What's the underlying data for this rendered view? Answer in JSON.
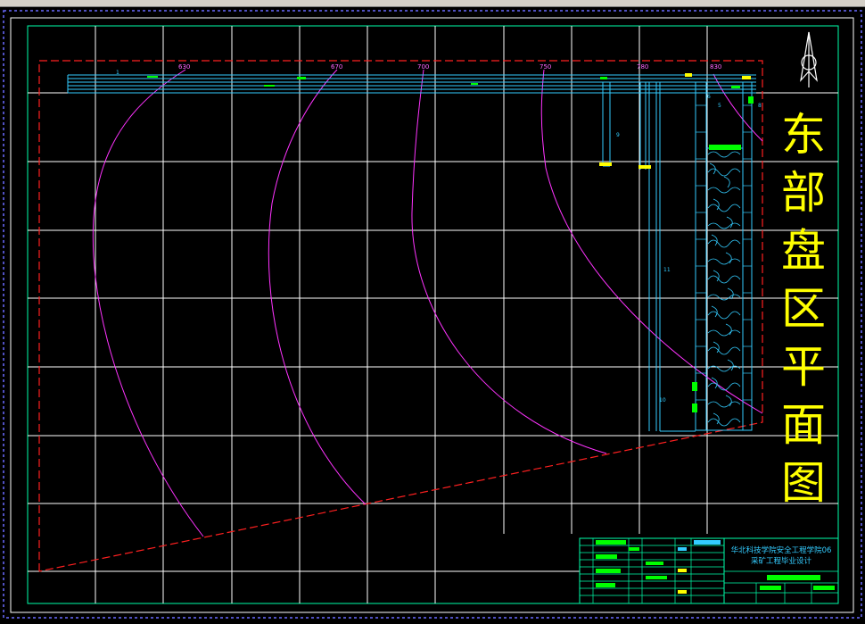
{
  "title_chars": [
    "东",
    "部",
    "盘",
    "区",
    "平",
    "面",
    "图"
  ],
  "contour_labels": [
    "630",
    "670",
    "700",
    "750",
    "780",
    "830"
  ],
  "tunnel_labels": [
    "9",
    "11",
    "10",
    "6",
    "5",
    "8",
    "1"
  ],
  "title_block": {
    "school_line1": "华北科技学院安全工程学院06",
    "school_line2": "采矿工程毕业设计"
  },
  "colors": {
    "frame": "#00ffaa",
    "grid": "#ffffff",
    "tunnel": "#33ccff",
    "contour": "#ff33ff",
    "title": "#ffff00",
    "boundary": "#ff2020",
    "accent": "#00ff00"
  }
}
